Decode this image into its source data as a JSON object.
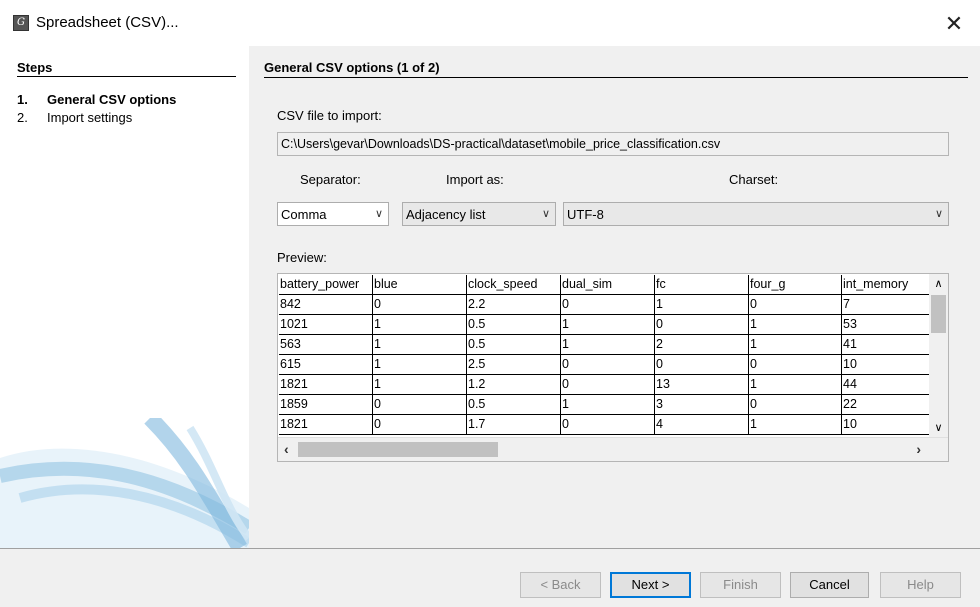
{
  "window": {
    "title": "Spreadsheet (CSV)...",
    "close_glyph": "✕",
    "app_icon_glyph": "G"
  },
  "steps": {
    "heading": "Steps",
    "items": [
      {
        "number": "1.",
        "label": "General CSV options",
        "active": true
      },
      {
        "number": "2.",
        "label": "Import settings",
        "active": false
      }
    ]
  },
  "panel": {
    "heading": "General CSV options (1 of 2)",
    "file_label": "CSV file to import:",
    "file_path": "C:\\Users\\gevar\\Downloads\\DS-practical\\dataset\\mobile_price_classification.csv",
    "separator_label": "Separator:",
    "import_as_label": "Import as:",
    "charset_label": "Charset:",
    "separator_value": "Comma",
    "import_as_value": "Adjacency list",
    "charset_value": "UTF-8",
    "preview_label": "Preview:"
  },
  "preview": {
    "columns": [
      "battery_power",
      "blue",
      "clock_speed",
      "dual_sim",
      "fc",
      "four_g",
      "int_memory"
    ],
    "rows": [
      [
        "842",
        "0",
        "2.2",
        "0",
        "1",
        "0",
        "7"
      ],
      [
        "1021",
        "1",
        "0.5",
        "1",
        "0",
        "1",
        "53"
      ],
      [
        "563",
        "1",
        "0.5",
        "1",
        "2",
        "1",
        "41"
      ],
      [
        "615",
        "1",
        "2.5",
        "0",
        "0",
        "0",
        "10"
      ],
      [
        "1821",
        "1",
        "1.2",
        "0",
        "13",
        "1",
        "44"
      ],
      [
        "1859",
        "0",
        "0.5",
        "1",
        "3",
        "0",
        "22"
      ],
      [
        "1821",
        "0",
        "1.7",
        "0",
        "4",
        "1",
        "10"
      ]
    ]
  },
  "buttons": {
    "back": "< Back",
    "next": "Next >",
    "finish": "Finish",
    "cancel": "Cancel",
    "help": "Help"
  },
  "icons": {
    "dropdown": "chevron-down-icon",
    "scroll_up": "chevron-up-icon",
    "scroll_down": "chevron-down-icon",
    "scroll_left": "chevron-left-icon",
    "scroll_right": "chevron-right-icon"
  },
  "colors": {
    "pane_bg": "#f0f0f0",
    "primary_border": "#0078d7",
    "decor_blue": "#8fc3e3"
  }
}
